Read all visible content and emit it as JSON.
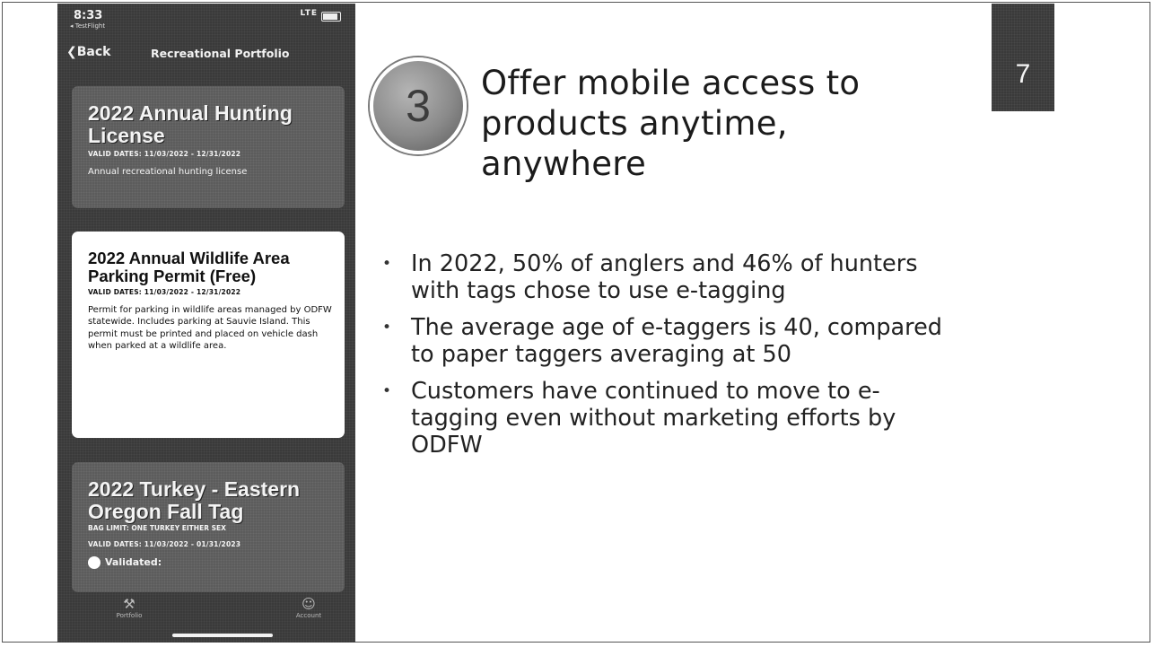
{
  "phone": {
    "status": {
      "time": "8:33",
      "back_app": "◂ TestFlight",
      "signal": "LTE"
    },
    "nav": {
      "back_label": "Back",
      "title": "Recreational Portfolio"
    },
    "cards": [
      {
        "title": "2022 Annual Hunting License",
        "dates": "VALID DATES: 11/03/2022 - 12/31/2022",
        "description": "Annual recreational hunting license"
      },
      {
        "title": "2022 Annual Wildlife Area Parking Permit (Free)",
        "dates": "VALID DATES: 11/03/2022 - 12/31/2022",
        "description": "Permit for parking in wildlife areas managed by ODFW statewide. Includes parking at Sauvie Island. This permit must be printed and placed on vehicle dash when parked at a wildlife area."
      },
      {
        "title": "2022 Turkey - Eastern Oregon Fall Tag",
        "bag_limit": "BAG LIMIT: ONE TURKEY EITHER SEX",
        "dates": "VALID DATES: 11/03/2022 - 01/31/2023",
        "validated_label": "Validated:"
      }
    ],
    "tabs": {
      "portfolio": "Portfolio",
      "account": "Account"
    }
  },
  "slide": {
    "number": "3",
    "heading": "Offer mobile access to products anytime, anywhere",
    "page_number": "7",
    "bullets": [
      "In 2022, 50% of anglers and 46% of hunters with tags chose to use e-tagging",
      "The average age of e-taggers is 40, compared to paper taggers averaging at 50",
      "Customers have continued to move to e-tagging even without marketing efforts by ODFW"
    ]
  }
}
